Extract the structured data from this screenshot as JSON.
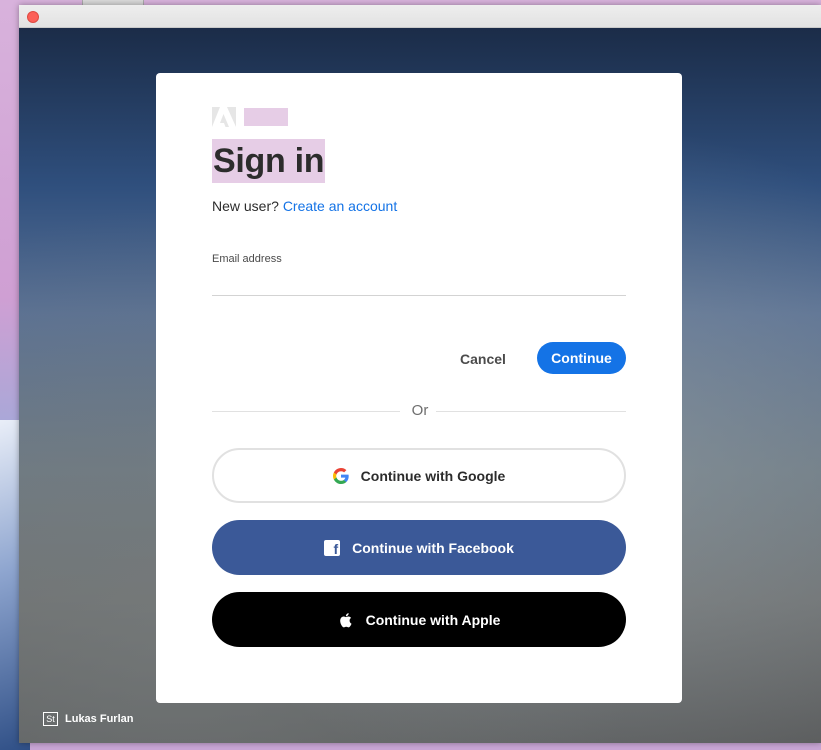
{
  "window": {
    "title": ""
  },
  "brand": {
    "name": "Adobe"
  },
  "signin": {
    "heading": "Sign in",
    "new_user_text": "New user?",
    "create_account_link": "Create an account",
    "email_label": "Email address",
    "email_value": "",
    "cancel_label": "Cancel",
    "continue_label": "Continue",
    "divider_text": "Or"
  },
  "social": {
    "google_label": "Continue with Google",
    "facebook_label": "Continue with Facebook",
    "apple_label": "Continue with Apple"
  },
  "photo_credit": {
    "badge": "St",
    "author": "Lukas Furlan"
  },
  "icons": [
    "adobe-logo-icon",
    "google-g-icon",
    "facebook-f-icon",
    "apple-logo-icon",
    "close-window-icon"
  ],
  "colors": {
    "accent": "#1473e6",
    "facebook": "#3b5998",
    "apple": "#000000",
    "highlight": "#e6cde6",
    "close_dot": "#fc5f57"
  }
}
